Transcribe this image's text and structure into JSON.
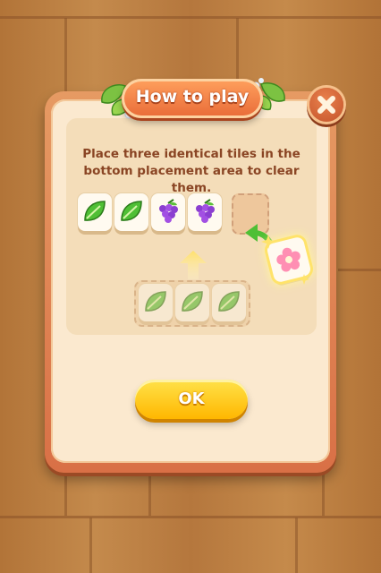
{
  "dialog": {
    "title": "How to play",
    "instruction": "Place three identical tiles in the bottom placement area to clear them.",
    "ok_label": "OK"
  },
  "top_row_tiles": [
    {
      "icon": "leaf-icon"
    },
    {
      "icon": "leaf-icon"
    },
    {
      "icon": "grape-icon"
    },
    {
      "icon": "grape-icon"
    }
  ],
  "placement_tray_tiles": [
    {
      "icon": "leaf-icon"
    },
    {
      "icon": "leaf-icon"
    },
    {
      "icon": "leaf-icon"
    }
  ],
  "moving_tile": {
    "icon": "flower-icon"
  },
  "colors": {
    "panel": "#fbe9cf",
    "frame": "#d97046",
    "ok_button": "#ffc21a",
    "title_text": "#ffffff",
    "instruction_text": "#8a4524"
  }
}
